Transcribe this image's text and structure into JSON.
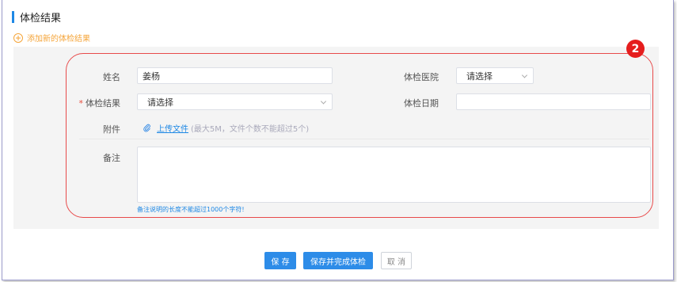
{
  "section": {
    "title": "体检结果"
  },
  "add_link": {
    "label": "添加新的体检结果"
  },
  "form": {
    "name": {
      "label": "姓名",
      "value": "姜杨"
    },
    "hospital": {
      "label": "体检医院",
      "value": "请选择"
    },
    "result": {
      "label": "体检结果",
      "required_mark": "*",
      "value": "请选择"
    },
    "date": {
      "label": "体检日期",
      "value": ""
    },
    "attachment": {
      "label": "附件",
      "upload_link": "上传文件",
      "hint": "(最大5M，文件个数不能超过5个)"
    },
    "remark": {
      "label": "备注",
      "value": "",
      "hint": "备注说明的长度不能超过1000个字符!"
    }
  },
  "callout": {
    "number": "2",
    "color": "#e51d1d"
  },
  "buttons": {
    "save": "保 存",
    "save_complete": "保存并完成体检",
    "cancel": "取 消"
  },
  "colors": {
    "accent": "#1e88e5",
    "add_link": "#f5a53a",
    "primary_button": "#2d8ce8"
  },
  "icons": {
    "add": "plus-circle-icon",
    "attachment": "paperclip-icon",
    "dropdown": "chevron-down-icon"
  }
}
